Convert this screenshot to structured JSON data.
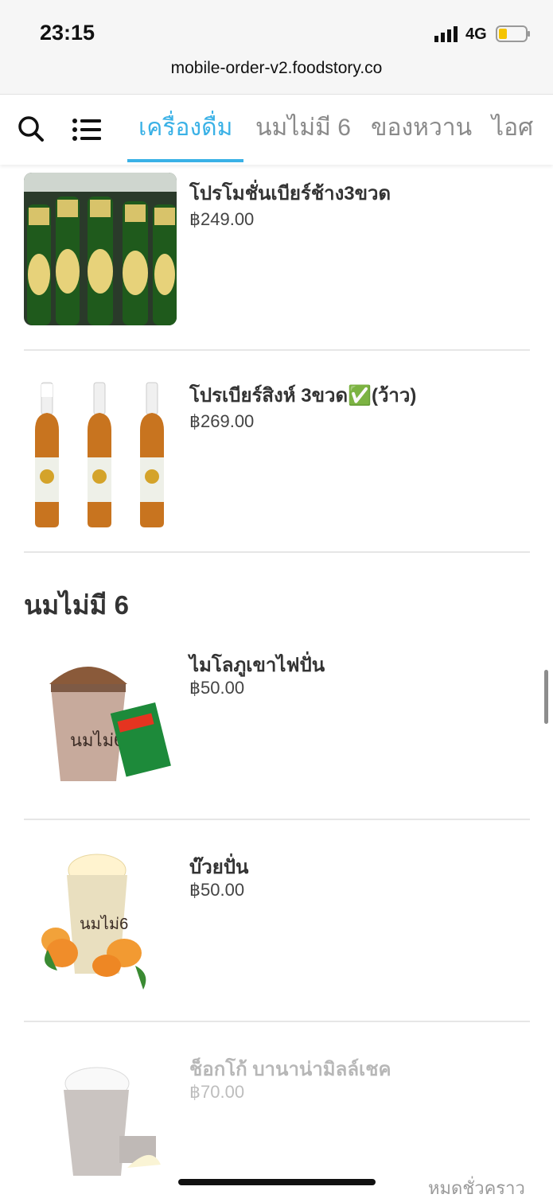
{
  "status_bar": {
    "time": "23:15",
    "network": "4G"
  },
  "browser": {
    "url": "mobile-order-v2.foodstory.co"
  },
  "nav": {
    "tabs": [
      {
        "label": "เครื่องดื่ม"
      },
      {
        "label": "นมไม่มี 6"
      },
      {
        "label": "ของหวาน"
      },
      {
        "label": "ไอศ"
      }
    ]
  },
  "menu": {
    "item1": {
      "name": "โปรโมชั่นเบียร์ช้าง3ขวด",
      "price": "฿249.00"
    },
    "item2": {
      "name": "โปรเบียร์สิงห์ 3ขวด✅(ว้าว)",
      "price": "฿269.00"
    },
    "section": {
      "title": "นมไม่มี 6"
    },
    "item3": {
      "name": "ไมโลภูเขาไฟปั่น",
      "price": "฿50.00"
    },
    "item4": {
      "name": "บ๊วยปั่น",
      "price": "฿50.00"
    },
    "item5": {
      "name": "ช็อกโก้ บานาน่ามิลล์เชค",
      "price": "฿70.00",
      "status": "หมดชั่วคราว"
    }
  },
  "colors": {
    "accent": "#3ab1e6",
    "battery": "#f5c400"
  }
}
